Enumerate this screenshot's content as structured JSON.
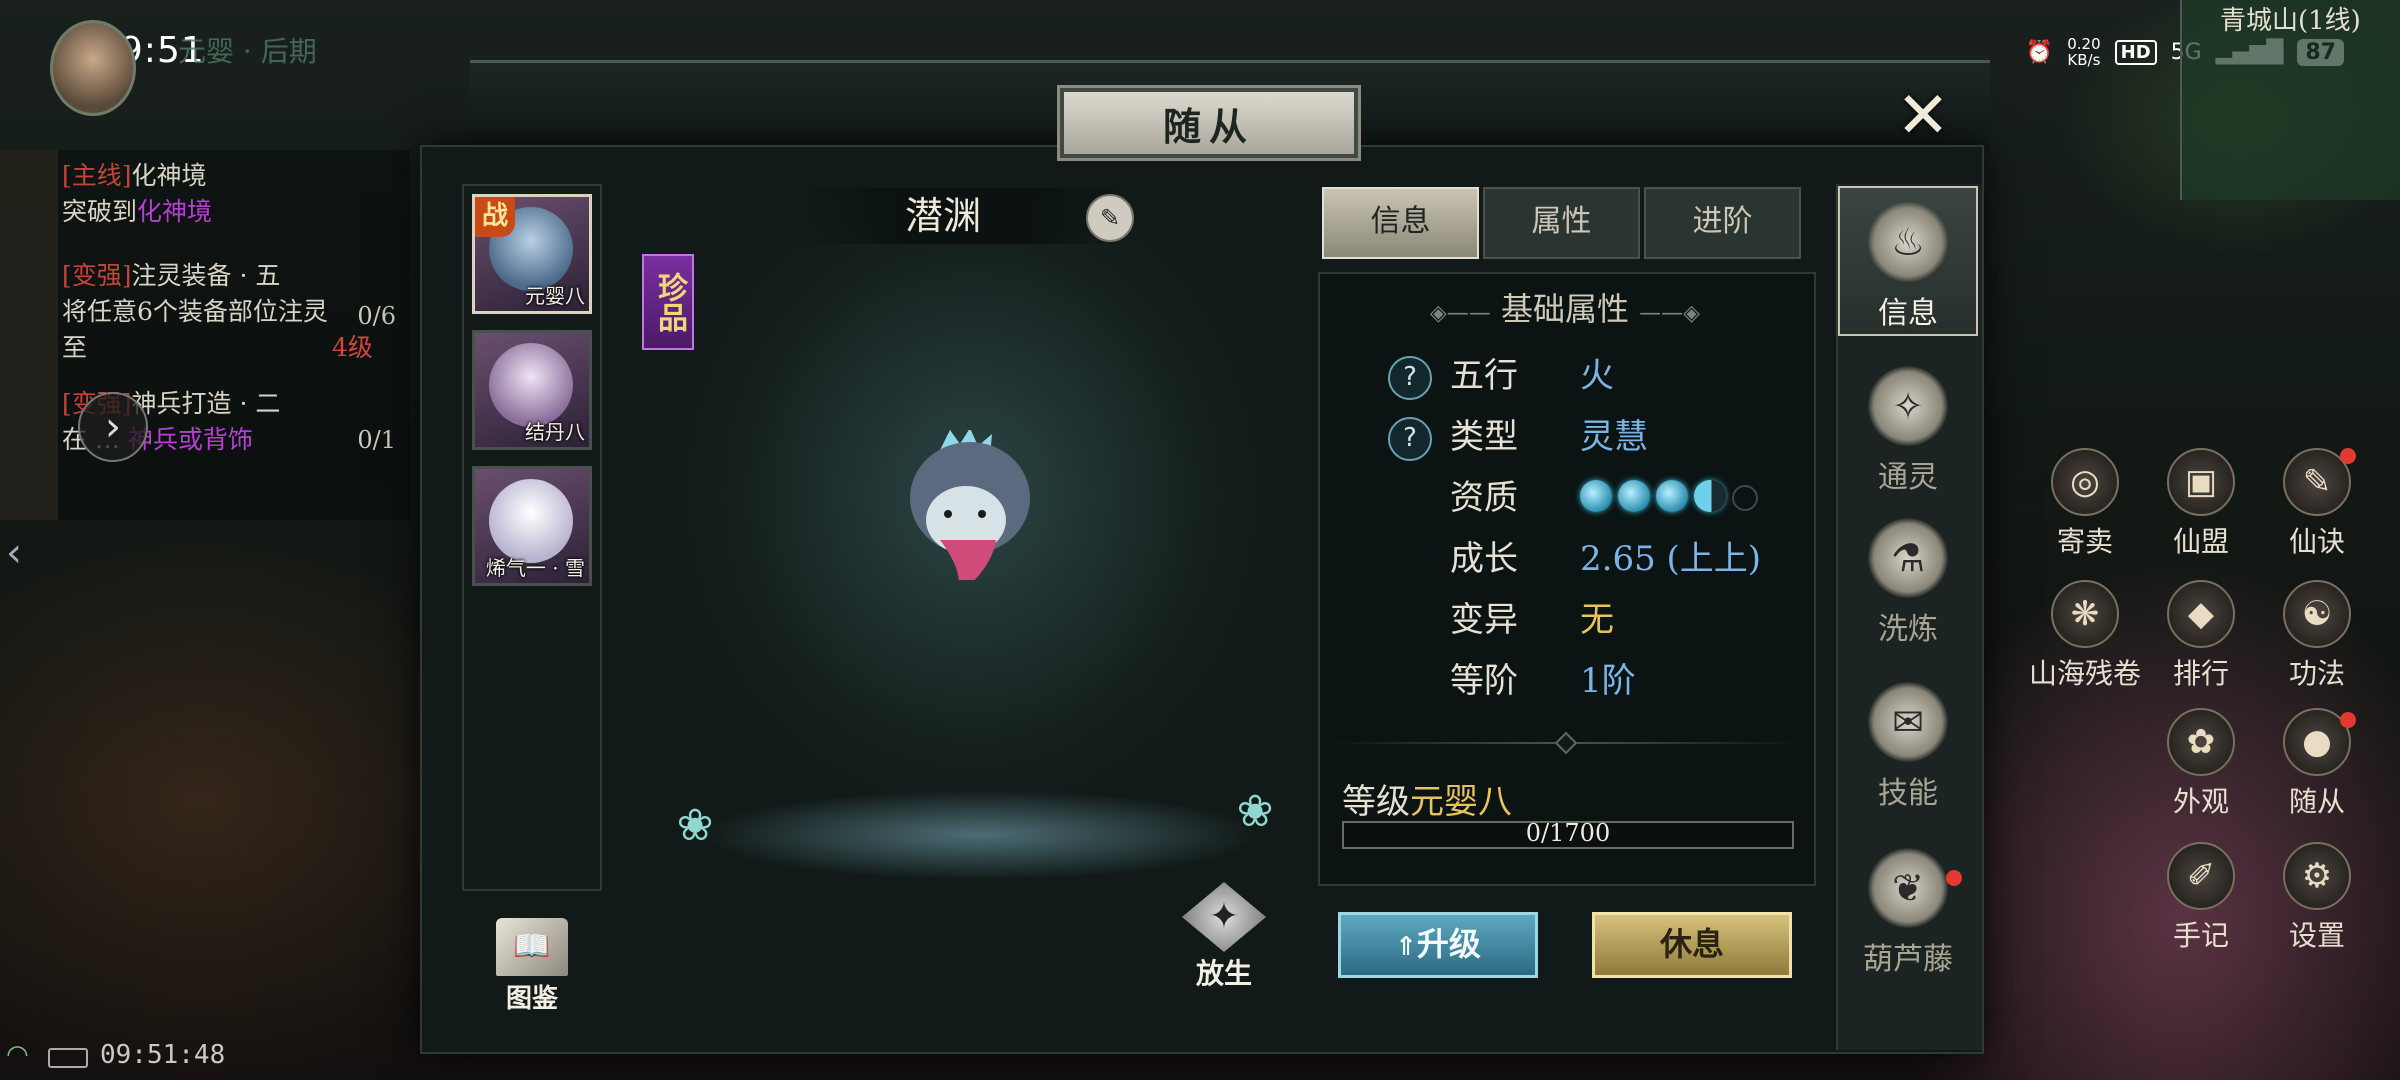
{
  "status_bar": {
    "time": "09:51",
    "net_speed_value": "0.20",
    "net_speed_unit": "KB/s",
    "hd_badge": "HD",
    "network": "5G",
    "battery": "87"
  },
  "player": {
    "realm": "元婴 · 后期"
  },
  "minimap": {
    "location": "青城山(1线)"
  },
  "quests": [
    {
      "tag": "[主线]",
      "title": "化神境",
      "desc_pre": "突破到",
      "desc_hl": "化神境",
      "count": ""
    },
    {
      "tag": "[变强]",
      "title": "注灵装备 · 五",
      "desc_pre": "将任意6个装备部位注灵至",
      "desc_hl": "4级",
      "count": "0/6"
    },
    {
      "tag": "[变强]",
      "title": "神兵打造 · 二",
      "desc_pre": "在",
      "desc_hl": "神兵或背饰",
      "count": "0/1"
    }
  ],
  "bottom": {
    "clock": "09:51:48"
  },
  "dialog": {
    "title": "随从",
    "close_icon": "close-icon"
  },
  "companions": [
    {
      "label": "元婴八",
      "active": true,
      "battle_badge": "战",
      "color": "#7da6c8"
    },
    {
      "label": "结丹八",
      "active": false,
      "color": "#e6d6f0"
    },
    {
      "label": "烯气一 · 雪",
      "active": false,
      "color": "#f2f2f6"
    }
  ],
  "handbook_label": "图鉴",
  "companion": {
    "name": "潜渊",
    "rarity": "珍品",
    "edit_icon": "pencil-icon"
  },
  "release_label": "放生",
  "tabs": [
    {
      "label": "信息",
      "active": true
    },
    {
      "label": "属性",
      "active": false
    },
    {
      "label": "进阶",
      "active": false
    }
  ],
  "basic_attrs": {
    "title": "基础属性",
    "rows": [
      {
        "label": "五行",
        "value": "火",
        "help": true
      },
      {
        "label": "类型",
        "value": "灵慧",
        "help": true
      },
      {
        "label": "资质",
        "value": "",
        "help": false,
        "orbs_full": 3,
        "orbs_half": 1,
        "orbs_empty": 1
      },
      {
        "label": "成长",
        "value": "2.65 (上上)",
        "help": false
      },
      {
        "label": "变异",
        "value": "无",
        "help": false,
        "gold": true
      },
      {
        "label": "等阶",
        "value": "1阶",
        "help": false
      }
    ]
  },
  "level": {
    "label": "等级",
    "value": "元婴八",
    "exp_text": "0/1700",
    "exp_fraction": 0
  },
  "buttons": {
    "upgrade": "升级",
    "rest": "休息"
  },
  "side_nav": [
    {
      "label": "信息",
      "active": true,
      "icon": "gourd-icon"
    },
    {
      "label": "通灵",
      "active": false,
      "icon": "spirit-icon"
    },
    {
      "label": "洗炼",
      "active": false,
      "icon": "refine-icon"
    },
    {
      "label": "技能",
      "active": false,
      "icon": "scroll-icon"
    },
    {
      "label": "葫芦藤",
      "active": false,
      "icon": "gourd-vine-icon",
      "badge": true
    }
  ],
  "hud_icons": [
    {
      "label": "寄卖",
      "icon": "coin-icon"
    },
    {
      "label": "仙盟",
      "icon": "alliance-icon"
    },
    {
      "label": "仙诀",
      "icon": "technique-icon"
    },
    {
      "label": "山海残卷",
      "icon": "map-scroll-icon"
    },
    {
      "label": "排行",
      "icon": "ranking-icon"
    },
    {
      "label": "功法",
      "icon": "yin-yang-icon"
    },
    {
      "label": "外观",
      "icon": "appearance-icon"
    },
    {
      "label": "随从",
      "icon": "companion-icon"
    },
    {
      "label": "手记",
      "icon": "notes-icon"
    },
    {
      "label": "设置",
      "icon": "gear-icon"
    }
  ],
  "colors": {
    "accent_gold": "#e8c35c",
    "value_blue": "#7cb4e6",
    "rarity_purple": "#7a2fa0"
  }
}
